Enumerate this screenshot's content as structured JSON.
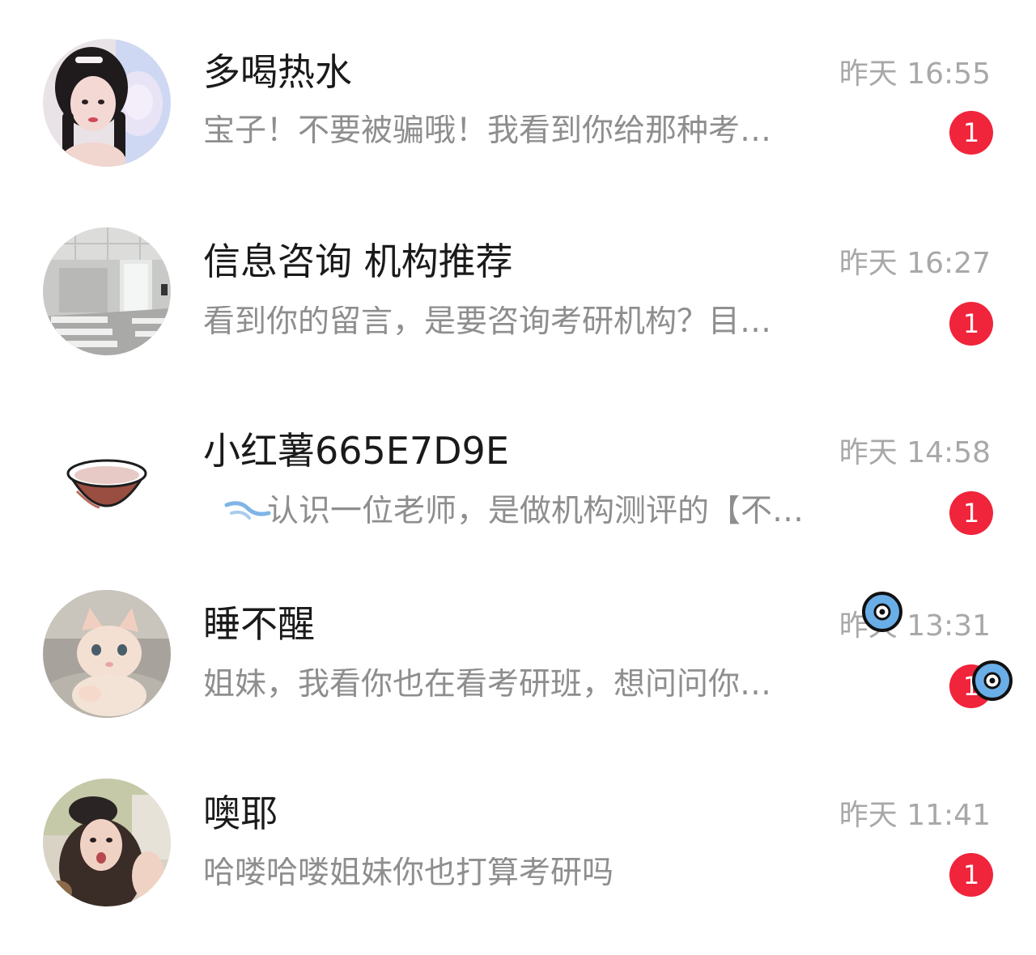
{
  "conversations": [
    {
      "name": "多喝热水",
      "time": "昨天 16:55",
      "preview": "宝子！不要被骗哦！我看到你给那种考…",
      "unread": "1",
      "avatar_icon": "girl-portrait-avatar"
    },
    {
      "name": "信息咨询 机构推荐",
      "time": "昨天 16:27",
      "preview": "看到你的留言，是要咨询考研机构？目…",
      "unread": "1",
      "avatar_icon": "classroom-avatar"
    },
    {
      "name": "小红薯665E7D9E",
      "time": "昨天 14:58",
      "preview": "认识一位老师，是做机构测评的【不…",
      "unread": "1",
      "avatar_icon": "bowl-avatar"
    },
    {
      "name": "睡不醒",
      "time": "昨天 13:31",
      "preview": "姐妹，我看你也在看考研班，想问问你…",
      "unread": "1",
      "avatar_icon": "kitten-avatar"
    },
    {
      "name": "噢耶",
      "time": "昨天 11:41",
      "preview": "哈喽哈喽姐妹你也打算考研吗",
      "unread": "1",
      "avatar_icon": "girl-selfie-avatar"
    }
  ],
  "colors": {
    "badge": "#f0243b",
    "name": "#1a1a1a",
    "preview": "#8e8e8e",
    "time": "#a8a8a8",
    "sticker_eye": "#6aaee8"
  }
}
